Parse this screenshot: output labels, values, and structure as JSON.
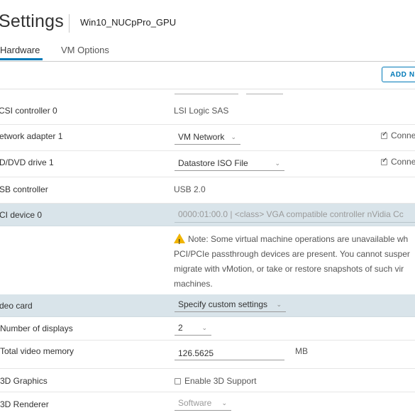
{
  "header": {
    "title": "Settings",
    "vm_name": "Win10_NUCpPro_GPU"
  },
  "tabs": [
    {
      "label": "Hardware",
      "active": true
    },
    {
      "label": "VM Options",
      "active": false
    }
  ],
  "toolbar": {
    "add_label": "ADD N"
  },
  "rows": {
    "scsi": {
      "label": "CSI controller 0",
      "value": "LSI Logic SAS"
    },
    "network": {
      "label": "etwork adapter 1",
      "value": "VM Network",
      "connect_label": "Conne",
      "connected": true
    },
    "dvd": {
      "label": "D/DVD drive 1",
      "value": "Datastore ISO File",
      "connect_label": "Conne",
      "connected": true
    },
    "usb": {
      "label": "SB controller",
      "value": "USB 2.0"
    },
    "pci": {
      "label": "CI device 0",
      "value": "0000:01:00.0 | <class> VGA compatible controller nVidia Cc",
      "note_lines": [
        "Note: Some virtual machine operations are unavailable wh",
        "PCI/PCIe passthrough devices are present. You cannot susper",
        "migrate with vMotion, or take or restore snapshots of such vir",
        "machines."
      ]
    },
    "video": {
      "label": "deo card",
      "value": "Specify custom settings"
    },
    "displays": {
      "label": "Number of displays",
      "value": "2"
    },
    "memory": {
      "label": "Total video memory",
      "value": "126.5625",
      "unit": "MB"
    },
    "graphics3d": {
      "label": "3D Graphics",
      "checkbox_label": "Enable 3D Support",
      "checked": false
    },
    "renderer": {
      "label": "3D Renderer",
      "value": "Software"
    }
  },
  "icons": {
    "warning": "warning-icon",
    "chevron": "chevron-down-icon",
    "checkbox": "checkbox-icon"
  },
  "colors": {
    "accent": "#0079b8",
    "highlight": "#d9e4ea",
    "warning": "#f0b400"
  }
}
